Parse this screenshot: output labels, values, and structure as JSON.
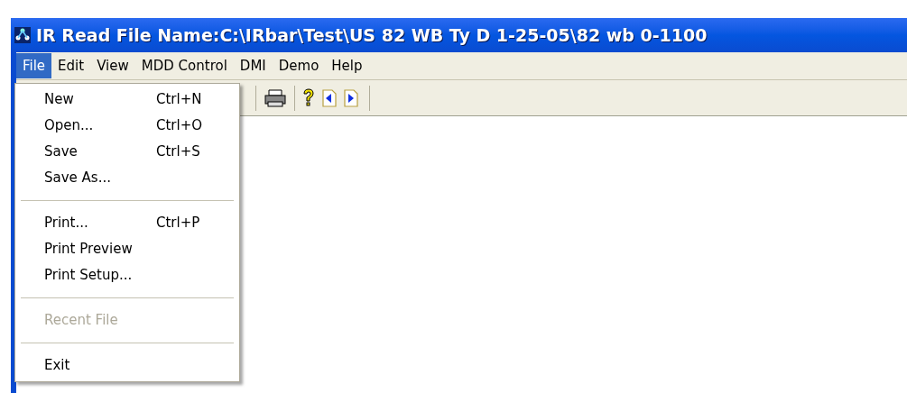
{
  "window": {
    "title": "IR Read File Name:C:\\IRbar\\Test\\US 82 WB Ty D 1-25-05\\82 wb 0-1100"
  },
  "menu_bar": [
    {
      "label": "File",
      "selected": true
    },
    {
      "label": "Edit",
      "selected": false
    },
    {
      "label": "View",
      "selected": false
    },
    {
      "label": "MDD Control",
      "selected": false
    },
    {
      "label": "DMI",
      "selected": false
    },
    {
      "label": "Demo",
      "selected": false
    },
    {
      "label": "Help",
      "selected": false
    }
  ],
  "file_menu": [
    {
      "kind": "item",
      "label": "New",
      "shortcut": "Ctrl+N",
      "disabled": false
    },
    {
      "kind": "item",
      "label": "Open...",
      "shortcut": "Ctrl+O",
      "disabled": false
    },
    {
      "kind": "item",
      "label": "Save",
      "shortcut": "Ctrl+S",
      "disabled": false
    },
    {
      "kind": "item",
      "label": "Save As...",
      "disabled": false
    },
    {
      "kind": "separator"
    },
    {
      "kind": "item",
      "label": "Print...",
      "shortcut": "Ctrl+P",
      "disabled": false
    },
    {
      "kind": "item",
      "label": "Print Preview",
      "disabled": false
    },
    {
      "kind": "item",
      "label": "Print Setup...",
      "disabled": false
    },
    {
      "kind": "separator"
    },
    {
      "kind": "item",
      "label": "Recent File",
      "disabled": true
    },
    {
      "kind": "separator"
    },
    {
      "kind": "item",
      "label": "Exit",
      "disabled": false
    }
  ]
}
